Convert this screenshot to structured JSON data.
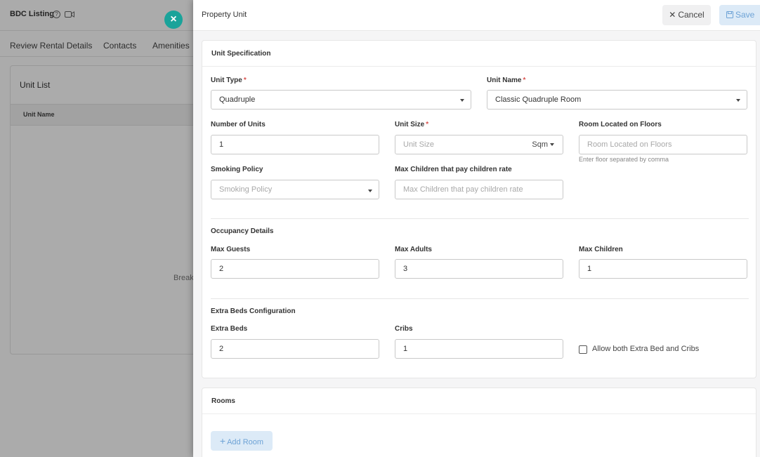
{
  "background": {
    "title": "BDC Listing",
    "tabs": [
      "Review Rental Details",
      "Contacts",
      "Amenities"
    ],
    "card_title": "Unit List",
    "table_header": "Unit Name",
    "partial_text": "Break"
  },
  "drawer": {
    "title": "Property Unit",
    "cancel_label": "Cancel",
    "save_label": "Save",
    "spec": {
      "title": "Unit Specification",
      "unit_type": {
        "label": "Unit Type",
        "value": "Quadruple"
      },
      "unit_name": {
        "label": "Unit Name",
        "value": "Classic Quadruple Room"
      },
      "number_of_units": {
        "label": "Number of Units",
        "value": "1"
      },
      "unit_size": {
        "label": "Unit Size",
        "placeholder": "Unit Size",
        "unit": "Sqm"
      },
      "floors": {
        "label": "Room Located on Floors",
        "placeholder": "Room Located on Floors",
        "helper": "Enter floor separated by comma"
      },
      "smoking": {
        "label": "Smoking Policy",
        "placeholder": "Smoking Policy"
      },
      "max_children_rate": {
        "label": "Max Children that pay children rate",
        "placeholder": "Max Children that pay children rate"
      }
    },
    "occupancy": {
      "title": "Occupancy Details",
      "max_guests": {
        "label": "Max Guests",
        "value": "2"
      },
      "max_adults": {
        "label": "Max Adults",
        "value": "3"
      },
      "max_children": {
        "label": "Max Children",
        "value": "1"
      }
    },
    "extra_beds": {
      "title": "Extra Beds Configuration",
      "extra_beds": {
        "label": "Extra Beds",
        "value": "2"
      },
      "cribs": {
        "label": "Cribs",
        "value": "1"
      },
      "allow_both": {
        "label": "Allow both Extra Bed and Cribs",
        "checked": false
      }
    },
    "rooms": {
      "title": "Rooms",
      "add_room_label": "Add Room"
    }
  },
  "colors": {
    "accent": "#1aa39a",
    "primary_light": "#dceaf7",
    "primary_text": "#6ea3d6",
    "required": "#d9534f"
  }
}
